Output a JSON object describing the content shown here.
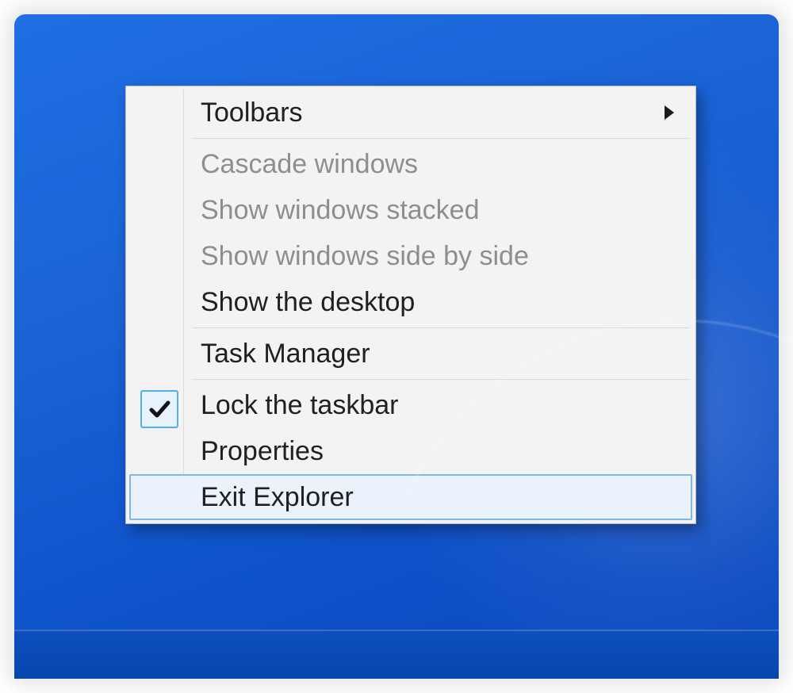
{
  "menu": {
    "items": [
      {
        "label": "Toolbars",
        "enabled": true,
        "hasSubmenu": true,
        "checked": false,
        "highlighted": false
      },
      {
        "label": "Cascade windows",
        "enabled": false,
        "hasSubmenu": false,
        "checked": false,
        "highlighted": false
      },
      {
        "label": "Show windows stacked",
        "enabled": false,
        "hasSubmenu": false,
        "checked": false,
        "highlighted": false
      },
      {
        "label": "Show windows side by side",
        "enabled": false,
        "hasSubmenu": false,
        "checked": false,
        "highlighted": false
      },
      {
        "label": "Show the desktop",
        "enabled": true,
        "hasSubmenu": false,
        "checked": false,
        "highlighted": false
      },
      {
        "label": "Task Manager",
        "enabled": true,
        "hasSubmenu": false,
        "checked": false,
        "highlighted": false
      },
      {
        "label": "Lock the taskbar",
        "enabled": true,
        "hasSubmenu": false,
        "checked": true,
        "highlighted": false
      },
      {
        "label": "Properties",
        "enabled": true,
        "hasSubmenu": false,
        "checked": false,
        "highlighted": false
      },
      {
        "label": "Exit Explorer",
        "enabled": true,
        "hasSubmenu": false,
        "checked": false,
        "highlighted": true
      }
    ]
  },
  "colors": {
    "desktop": "#1a63d6",
    "taskbar": "#0a47bd",
    "menuBg": "#f3f3f3",
    "menuBorder": "#b9b9b9",
    "hoverBg": "#eaf3fb",
    "hoverBorder": "#7fb8e8",
    "disabledText": "#8e8e8e",
    "checkBg": "#e6f3fc",
    "checkBorder": "#55b0e8"
  }
}
